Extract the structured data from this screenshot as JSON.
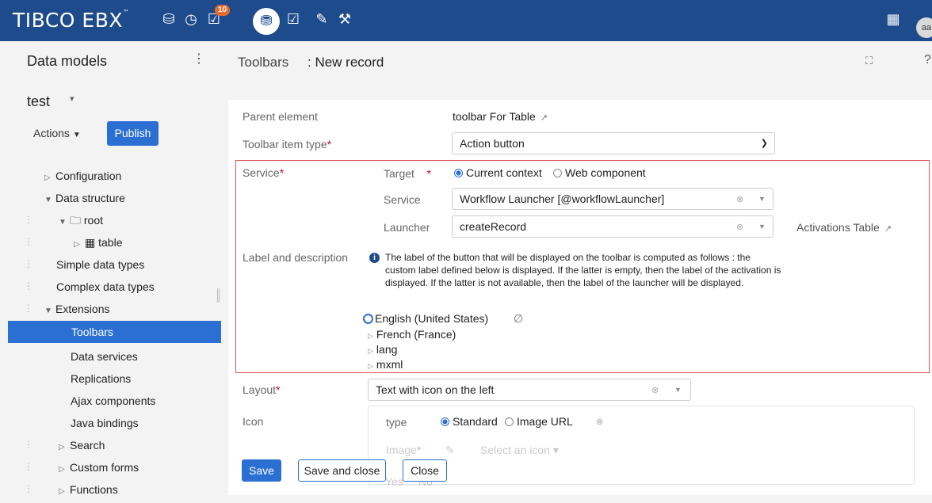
{
  "topbar": {
    "brand": "TIBCO EBX",
    "brand_mark": "™",
    "badge_count": "10",
    "avatar_initials": "aa",
    "icons": [
      "database-icon",
      "clock-icon",
      "tasks-icon",
      "data-icon",
      "checklist-icon",
      "plugin-icon",
      "wrench-icon",
      "grid-icon"
    ]
  },
  "sidebar": {
    "title": "Data models",
    "project": "test",
    "actions_label": "Actions",
    "publish_label": "Publish",
    "tree": {
      "configuration": "Configuration",
      "data_structure": "Data structure",
      "root": "root",
      "table": "table",
      "simple_types": "Simple data types",
      "complex_types": "Complex data types",
      "extensions": "Extensions",
      "toolbars": "Toolbars",
      "data_services": "Data services",
      "replications": "Replications",
      "ajax_components": "Ajax components",
      "java_bindings": "Java bindings",
      "search": "Search",
      "custom_forms": "Custom forms",
      "functions": "Functions"
    }
  },
  "header": {
    "section": "Toolbars",
    "record": ": New record"
  },
  "form": {
    "parent_label": "Parent element",
    "parent_value": "toolbar For Table",
    "item_type_label": "Toolbar item type",
    "item_type_value": "Action button",
    "service_label": "Service",
    "target_label": "Target",
    "target_opt1": "Current context",
    "target_opt2": "Web component",
    "service_field_label": "Service",
    "service_field_value": "Workflow Launcher [@workflowLauncher]",
    "launcher_label": "Launcher",
    "launcher_value": "createRecord",
    "activations_link": "Activations Table",
    "label_desc_label": "Label and description",
    "info_text": "The label of the button that will be displayed on the toolbar is computed as follows : the custom label defined below is displayed. If the latter is empty, then the label of the activation is displayed. If the latter is not available, then the label of the launcher will be displayed.",
    "langs": [
      "English (United States)",
      "French (France)",
      "lang",
      "mxml"
    ],
    "layout_label": "Layout",
    "layout_value": "Text with icon on the left",
    "icon_label": "Icon",
    "icon_type_label": "type",
    "icon_type_opt1": "Standard",
    "icon_type_opt2": "Image URL",
    "image_label": "Image",
    "image_placeholder": "Select an icon",
    "row_hidden_label": "Yes",
    "row_hidden_opt2": "No"
  },
  "buttons": {
    "save": "Save",
    "save_close": "Save and close",
    "close": "Close"
  },
  "colors": {
    "topbar": "#1e4b8c",
    "accent": "#2a6fd1",
    "error_border": "#e05252"
  }
}
